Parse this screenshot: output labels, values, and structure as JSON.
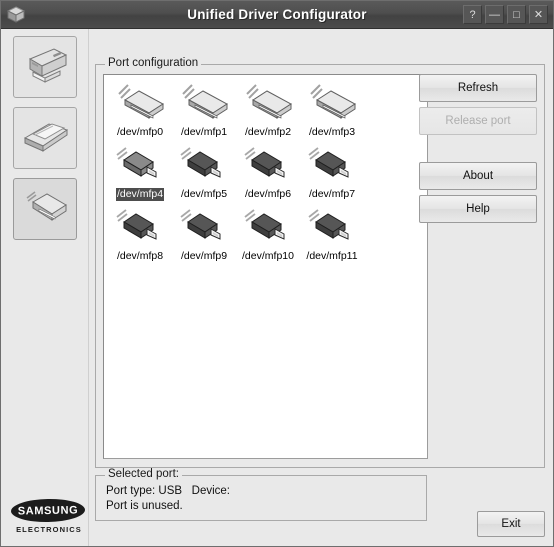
{
  "window": {
    "title": "Unified Driver Configurator",
    "icon": "app-cube-icon",
    "titlebar_buttons": [
      {
        "name": "help-button",
        "glyph": "?"
      },
      {
        "name": "minimize-button",
        "glyph": "—"
      },
      {
        "name": "maximize-button",
        "glyph": "□"
      },
      {
        "name": "close-button",
        "glyph": "✕"
      }
    ]
  },
  "sidebar": {
    "items": [
      {
        "name": "printers-configuration-button",
        "icon": "printer-icon",
        "active": false
      },
      {
        "name": "scanners-configuration-button",
        "icon": "scanner-icon",
        "active": false
      },
      {
        "name": "ports-configuration-button",
        "icon": "port-icon",
        "active": true
      }
    ],
    "logo": {
      "brand": "SAMSUNG",
      "sub": "ELECTRONICS"
    }
  },
  "main": {
    "port_configuration": {
      "legend": "Port configuration",
      "ports": [
        {
          "label": "/dev/mfp0",
          "type": "parallel",
          "selected": false
        },
        {
          "label": "/dev/mfp1",
          "type": "parallel",
          "selected": false
        },
        {
          "label": "/dev/mfp2",
          "type": "parallel",
          "selected": false
        },
        {
          "label": "/dev/mfp3",
          "type": "parallel",
          "selected": false
        },
        {
          "label": "/dev/mfp4",
          "type": "usb",
          "selected": true
        },
        {
          "label": "/dev/mfp5",
          "type": "usb",
          "selected": false
        },
        {
          "label": "/dev/mfp6",
          "type": "usb",
          "selected": false
        },
        {
          "label": "/dev/mfp7",
          "type": "usb",
          "selected": false
        },
        {
          "label": "/dev/mfp8",
          "type": "usb",
          "selected": false
        },
        {
          "label": "/dev/mfp9",
          "type": "usb",
          "selected": false
        },
        {
          "label": "/dev/mfp10",
          "type": "usb",
          "selected": false
        },
        {
          "label": "/dev/mfp11",
          "type": "usb",
          "selected": false
        }
      ],
      "buttons": [
        {
          "name": "refresh-button",
          "label": "Refresh",
          "disabled": false
        },
        {
          "name": "release-port-button",
          "label": "Release port",
          "disabled": true
        },
        {
          "name": "about-button",
          "label": "About",
          "disabled": false
        },
        {
          "name": "help-button",
          "label": "Help",
          "disabled": false
        }
      ]
    },
    "selected_port": {
      "legend": "Selected port:",
      "line1": "Port type: USB   Device:",
      "line2": "Port is unused."
    }
  },
  "footer": {
    "exit_label": "Exit"
  }
}
